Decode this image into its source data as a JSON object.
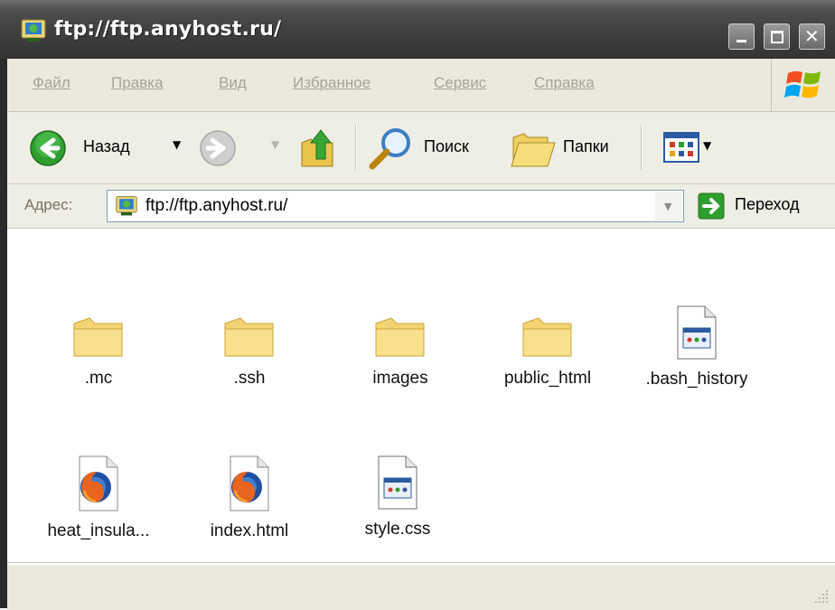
{
  "window": {
    "title": "ftp://ftp.anyhost.ru/"
  },
  "menu": [
    "Файл",
    "Правка",
    "Вид",
    "Избранное",
    "Сервис",
    "Справка"
  ],
  "toolbar": {
    "back_label": "Назад",
    "search_label": "Поиск",
    "folders_label": "Папки"
  },
  "address": {
    "label": "Адрес:",
    "value": "ftp://ftp.anyhost.ru/",
    "go_label": "Переход"
  },
  "items": [
    {
      "name": ".mc",
      "type": "folder"
    },
    {
      "name": ".ssh",
      "type": "folder"
    },
    {
      "name": "images",
      "type": "folder"
    },
    {
      "name": "public_html",
      "type": "folder"
    },
    {
      "name": ".bash_history",
      "type": "text-file"
    },
    {
      "name": "heat_insula...",
      "type": "firefox-html"
    },
    {
      "name": "index.html",
      "type": "firefox-html"
    },
    {
      "name": "style.css",
      "type": "text-file"
    }
  ],
  "colors": {
    "title_bg": "#3f3f3f",
    "menu_bg": "#ebe9de",
    "toolbar_bg": "#efeee5",
    "menu_text": "#a6a497",
    "go_green": "#2f9e2f"
  }
}
